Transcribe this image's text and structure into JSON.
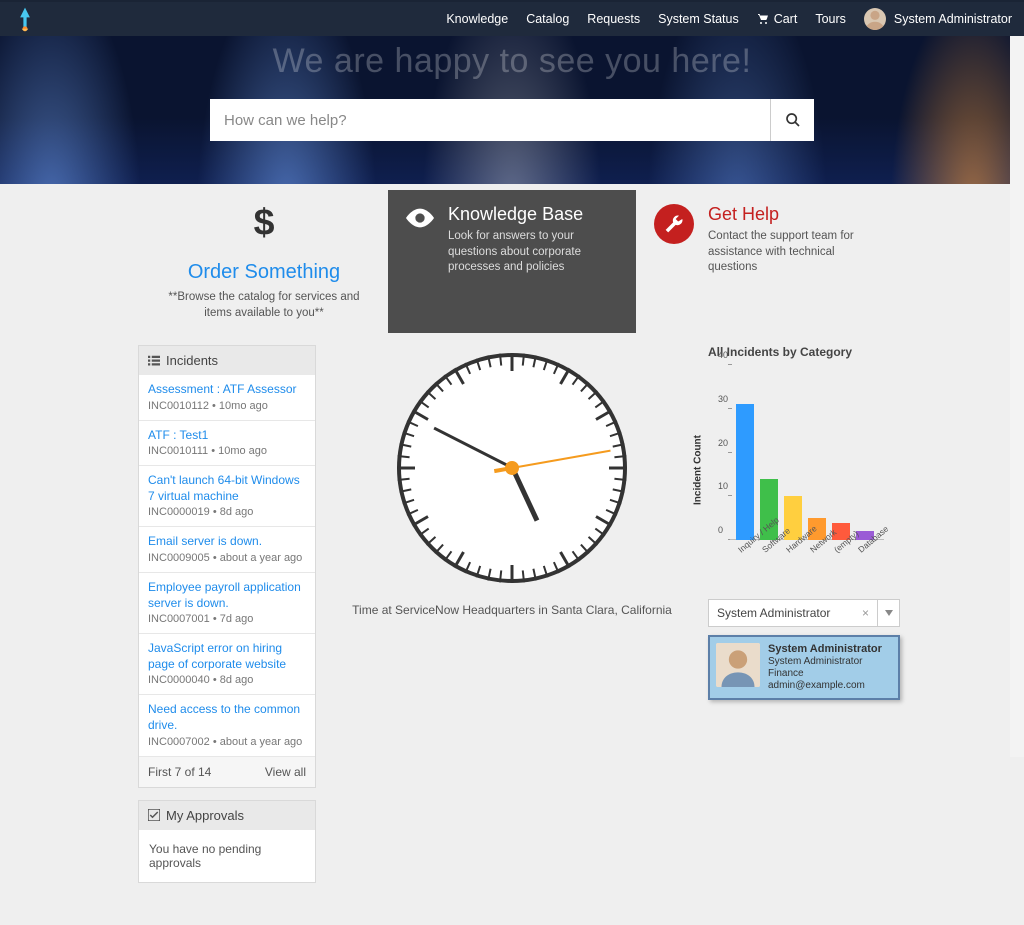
{
  "nav": {
    "items": [
      "Knowledge",
      "Catalog",
      "Requests",
      "System Status"
    ],
    "cart": "Cart",
    "tours": "Tours",
    "user": "System Administrator"
  },
  "hero": {
    "title": "We are happy to see you here!",
    "search_placeholder": "How can we help?"
  },
  "cards": {
    "order": {
      "title": "Order Something",
      "sub": "**Browse the catalog for services and items available to you**"
    },
    "kb": {
      "title": "Knowledge Base",
      "sub": "Look for answers to your questions about corporate processes and policies"
    },
    "help": {
      "title": "Get Help",
      "sub": "Contact the support team for assistance with technical questions"
    }
  },
  "incidents_header": "Incidents",
  "incidents": [
    {
      "title": "Assessment : ATF Assessor",
      "meta": "INC0010112 • 10mo ago"
    },
    {
      "title": "ATF : Test1",
      "meta": "INC0010111 • 10mo ago"
    },
    {
      "title": "Can't launch 64-bit Windows 7 virtual machine",
      "meta": "INC0000019 • 8d ago"
    },
    {
      "title": "Email server is down.",
      "meta": "INC0009005 • about a year ago"
    },
    {
      "title": "Employee payroll application server is down.",
      "meta": "INC0007001 • 7d ago"
    },
    {
      "title": "JavaScript error on hiring page of corporate website",
      "meta": "INC0000040 • 8d ago"
    },
    {
      "title": "Need access to the common drive.",
      "meta": "INC0007002 • about a year ago"
    }
  ],
  "incidents_footer": {
    "count": "First 7 of 14",
    "viewall": "View all"
  },
  "approvals": {
    "header": "My Approvals",
    "body": "You have no pending approvals"
  },
  "clock_caption": "Time at ServiceNow Headquarters in Santa Clara, California",
  "chart_title": "All Incidents by Category",
  "chart_data": {
    "type": "bar",
    "categories": [
      "Inquiry / Help",
      "Software",
      "Hardware",
      "Network",
      "(empty)",
      "Database"
    ],
    "values": [
      31,
      14,
      10,
      5,
      4,
      2
    ],
    "ylabel": "Incident Count",
    "yticks": [
      0,
      10,
      20,
      30,
      40
    ],
    "ylim": [
      0,
      40
    ],
    "colors": [
      "#2e9bff",
      "#3fbf4a",
      "#ffcf3f",
      "#ff9a2e",
      "#ff5a3c",
      "#9a5bd6"
    ]
  },
  "user_select": {
    "value": "System Administrator"
  },
  "user_card": {
    "name": "System Administrator",
    "role": "System Administrator",
    "dept": "Finance",
    "email": "admin@example.com"
  }
}
